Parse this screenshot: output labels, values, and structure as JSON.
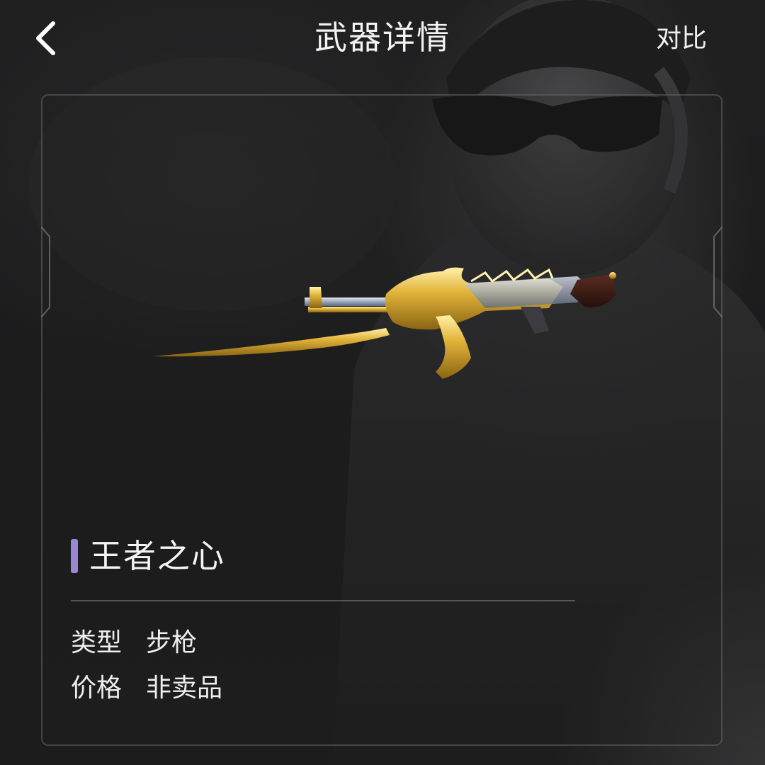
{
  "header": {
    "title": "武器详情",
    "compare_label": "对比"
  },
  "weapon": {
    "name": "王者之心",
    "accent_color": "#9b86d6",
    "attributes": [
      {
        "label": "类型",
        "value": "步枪"
      },
      {
        "label": "价格",
        "value": "非卖品"
      }
    ]
  },
  "icons": {
    "back": "chevron-left-icon"
  }
}
